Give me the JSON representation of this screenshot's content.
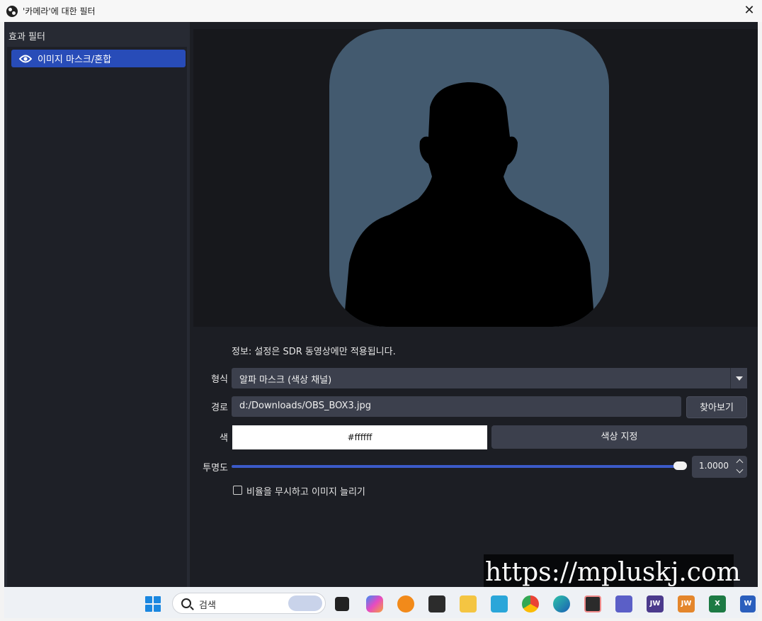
{
  "window": {
    "title": "'카메라'에 대한 필터",
    "close_label": "✕"
  },
  "sidebar": {
    "title": "효과 필터",
    "filters": [
      {
        "label": "이미지 마스크/혼합",
        "visible": true,
        "selected": true
      }
    ]
  },
  "settings": {
    "info": "정보: 설정은 SDR 동영상에만 적용됩니다.",
    "type": {
      "label": "형식",
      "value": "알파 마스크 (색상 채널)"
    },
    "path": {
      "label": "경로",
      "value": "d:/Downloads/OBS_BOX3.jpg",
      "browse_label": "찾아보기"
    },
    "color": {
      "label": "색",
      "value": "#ffffff",
      "pick_label": "색상 지정"
    },
    "opacity": {
      "label": "투명도",
      "value": "1.0000",
      "fraction": 1.0
    },
    "stretch": {
      "label": "비율을 무시하고 이미지 늘리기",
      "checked": false
    }
  },
  "watermark": "https://mpluskj.com",
  "taskbar": {
    "search_placeholder": "검색",
    "apps": [
      "task-view",
      "copilot",
      "search-everything",
      "voicemeeter",
      "file-explorer",
      "onenote",
      "chrome",
      "edge-dev",
      "sticky-notes",
      "teams",
      "jw-library",
      "jw-library-alt",
      "excel",
      "word"
    ]
  },
  "colors": {
    "selection": "#284cb8",
    "background": "#1c1e24",
    "mask": "#435a6f",
    "slider": "#3b5ac8"
  }
}
